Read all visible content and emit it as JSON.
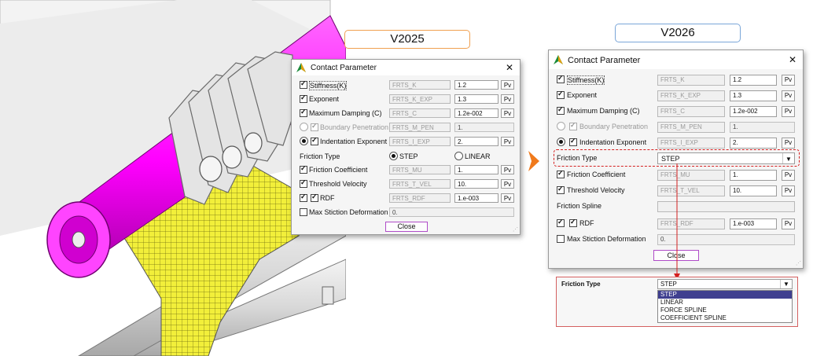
{
  "versions": {
    "old": "V2025",
    "new": "V2026"
  },
  "dialog_old": {
    "title": "Contact Parameter",
    "close_x": "✕",
    "stiffness": {
      "label": "Stiffness(K)",
      "name": "FRTS_K",
      "value": "1.2",
      "pv": "Pv"
    },
    "exponent": {
      "label": "Exponent",
      "name": "FRTS_K_EXP",
      "value": "1.3",
      "pv": "Pv"
    },
    "damping": {
      "label": "Maximum Damping (C)",
      "name": "FRTS_C",
      "value": "1.2e-002",
      "pv": "Pv"
    },
    "boundary": {
      "label": "Boundary Penetration",
      "name": "FRTS_M_PEN",
      "value": "1."
    },
    "indentation": {
      "label": "Indentation Exponent",
      "name": "FRTS_I_EXP",
      "value": "2.",
      "pv": "Pv"
    },
    "friction_type": {
      "label": "Friction Type",
      "opt_step": "STEP",
      "opt_linear": "LINEAR"
    },
    "friction_coef": {
      "label": "Friction Coefficient",
      "name": "FRTS_MU",
      "value": "1.",
      "pv": "Pv"
    },
    "threshold": {
      "label": "Threshold Velocity",
      "name": "FRTS_T_VEL",
      "value": "10.",
      "pv": "Pv"
    },
    "rdf": {
      "label": "RDF",
      "name": "FRTS_RDF",
      "value": "1.e-003",
      "pv": "Pv"
    },
    "max_stiction": {
      "label": "Max Stiction Deformation",
      "value": "0."
    },
    "close_button": "Close"
  },
  "dialog_new": {
    "title": "Contact Parameter",
    "close_x": "✕",
    "stiffness": {
      "label": "Stiffness(K)",
      "name": "FRTS_K",
      "value": "1.2",
      "pv": "Pv"
    },
    "exponent": {
      "label": "Exponent",
      "name": "FRTS_K_EXP",
      "value": "1.3",
      "pv": "Pv"
    },
    "damping": {
      "label": "Maximum Damping (C)",
      "name": "FRTS_C",
      "value": "1.2e-002",
      "pv": "Pv"
    },
    "boundary": {
      "label": "Boundary Penetration",
      "name": "FRTS_M_PEN",
      "value": "1."
    },
    "indentation": {
      "label": "Indentation Exponent",
      "name": "FRTS_I_EXP",
      "value": "2.",
      "pv": "Pv"
    },
    "friction_type": {
      "label": "Friction Type",
      "value": "STEP"
    },
    "friction_coef": {
      "label": "Friction Coefficient",
      "name": "FRTS_MU",
      "value": "1.",
      "pv": "Pv"
    },
    "threshold": {
      "label": "Threshold Velocity",
      "name": "FRTS_T_VEL",
      "value": "10.",
      "pv": "Pv"
    },
    "friction_spline": {
      "label": "Friction Spline"
    },
    "rdf": {
      "label": "RDF",
      "name": "FRTS_RDF",
      "value": "1.e-003",
      "pv": "Pv"
    },
    "max_stiction": {
      "label": "Max Stiction Deformation",
      "value": "0."
    },
    "close_button": "Close"
  },
  "dropdown_popup": {
    "label": "Friction Type",
    "value": "STEP",
    "options": [
      "STEP",
      "LINEAR",
      "FORCE SPLINE",
      "COEFFICIENT SPLINE"
    ]
  },
  "colors": {
    "magenta": "#ff00ff",
    "belt_yellow": "#f2ef3a",
    "old_label_border": "#f0a050",
    "new_label_border": "#7aa6d8",
    "arrow_orange": "#f07a1c",
    "highlight_red": "#d42020",
    "selected_option": "#3f3f8f"
  }
}
